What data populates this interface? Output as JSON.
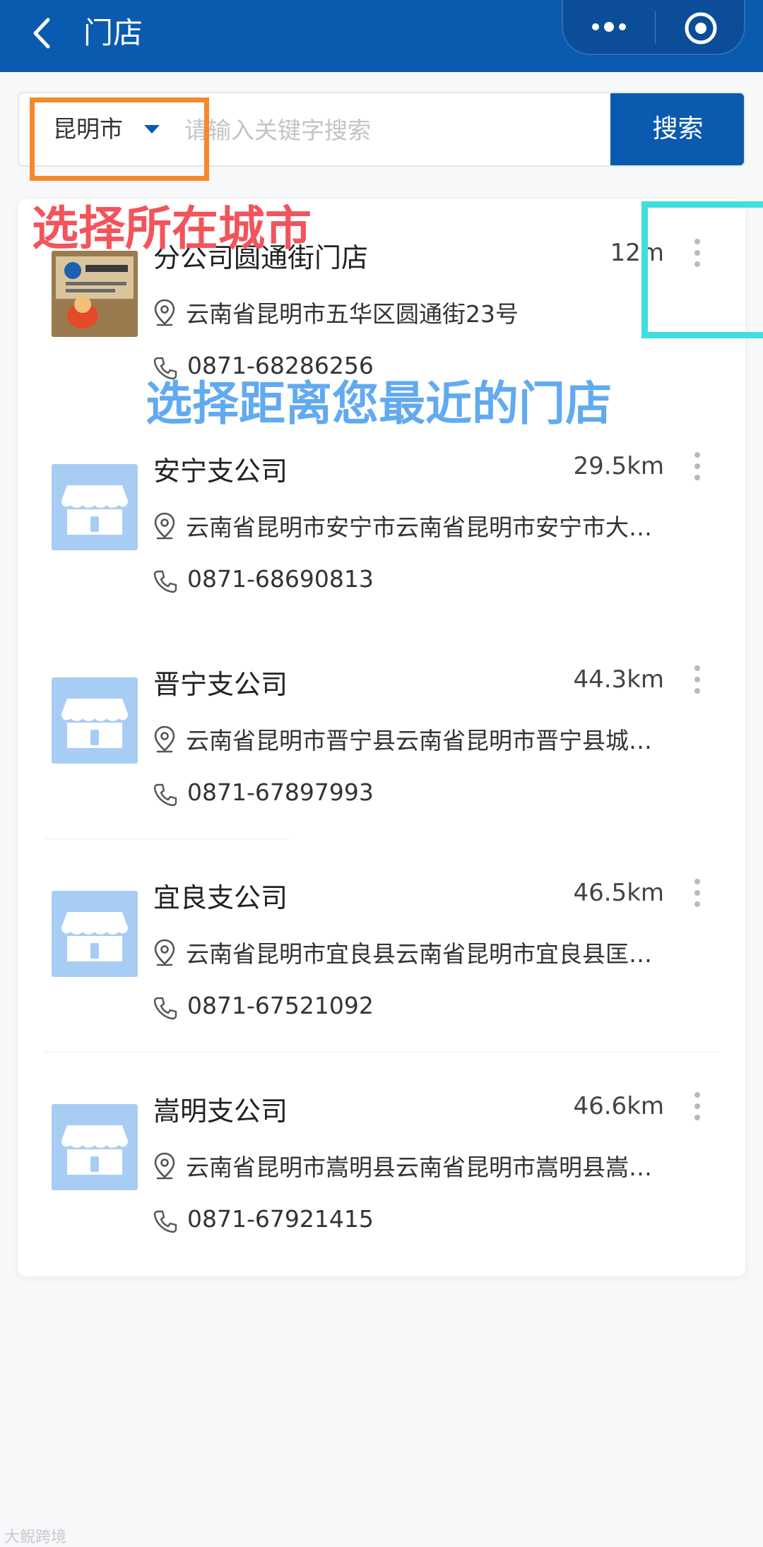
{
  "header": {
    "title": "门店",
    "back_icon": "back-chevron-icon",
    "more_icon": "more-dots-icon",
    "close_icon": "target-circle-icon"
  },
  "search": {
    "city": "昆明市",
    "placeholder": "请输入关键字搜索",
    "button": "搜索"
  },
  "annotations": {
    "select_city": "选择所在城市",
    "select_nearest": "选择距离您最近的门店"
  },
  "stores": [
    {
      "name": "分公司圆通街门店",
      "distance": "12m",
      "address": "云南省昆明市五华区圆通街23号",
      "phone": "0871-68286256"
    },
    {
      "name": "安宁支公司",
      "distance": "29.5km",
      "address": "云南省昆明市安宁市云南省昆明市安宁市大…",
      "phone": "0871-68690813"
    },
    {
      "name": "晋宁支公司",
      "distance": "44.3km",
      "address": "云南省昆明市晋宁县云南省昆明市晋宁县城…",
      "phone": "0871-67897993"
    },
    {
      "name": "宜良支公司",
      "distance": "46.5km",
      "address": "云南省昆明市宜良县云南省昆明市宜良县匡…",
      "phone": "0871-67521092"
    },
    {
      "name": "嵩明支公司",
      "distance": "46.6km",
      "address": "云南省昆明市嵩明县云南省昆明市嵩明县嵩…",
      "phone": "0871-67921415"
    }
  ],
  "colors": {
    "brand": "#0a5ab0",
    "annotation_red": "#f2545b",
    "annotation_blue": "#62aaf0",
    "box_orange": "#f6882c",
    "box_cyan": "#40dede"
  },
  "watermark": "大鲵跨境"
}
